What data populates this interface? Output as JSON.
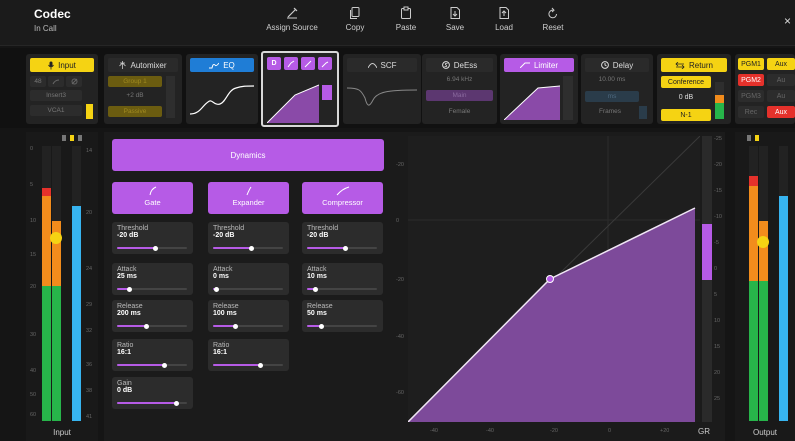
{
  "app": {
    "title": "Codec",
    "subtitle": "In Call",
    "close": "×"
  },
  "toolbar": [
    {
      "label": "Assign Source",
      "icon": "pen-icon"
    },
    {
      "label": "Copy",
      "icon": "copy-icon"
    },
    {
      "label": "Paste",
      "icon": "paste-icon"
    },
    {
      "label": "Save",
      "icon": "save-icon"
    },
    {
      "label": "Load",
      "icon": "load-icon"
    },
    {
      "label": "Reset",
      "icon": "reset-icon"
    }
  ],
  "modules": {
    "input": {
      "label": "Input",
      "row1": [
        "48",
        "",
        ""
      ],
      "row2": "Insert3",
      "row3": "VCA1"
    },
    "automixer": {
      "label": "Automixer",
      "group": "Group 1",
      "gain": "+2 dB",
      "mode": "Passive"
    },
    "eq": {
      "label": "EQ"
    },
    "dyn": {
      "tab": "D"
    },
    "scf": {
      "label": "SCF"
    },
    "deess": {
      "label": "DeEss",
      "freq": "6.94 kHz",
      "mode": "Main",
      "voice": "Female"
    },
    "limiter": {
      "label": "Limiter"
    },
    "delay": {
      "label": "Delay",
      "time": "10.00 ms",
      "unit": "ms",
      "mode": "Frames"
    },
    "return": {
      "label": "Return",
      "source": "Conference",
      "level": "0 dB",
      "mix": "N-1"
    },
    "pgm": {
      "p1": "PGM1",
      "p2": "PGM2",
      "p3": "PGM3",
      "rec": "Rec",
      "aux1": "Aux",
      "aux2": "Au",
      "aux3": "Au",
      "aux4": "Aux"
    }
  },
  "meters": {
    "input_label": "Input",
    "output_label": "Output",
    "scale": [
      "0",
      "5",
      "10",
      "15",
      "20",
      "30",
      "40",
      "50",
      "60"
    ],
    "scale_right": [
      "14",
      "20",
      "24",
      "29",
      "32",
      "36",
      "38",
      "41"
    ],
    "input_level": 0.61,
    "input_level_b": 0.72
  },
  "dynamics": {
    "title": "Dynamics",
    "buttons": [
      "Gate",
      "Expander",
      "Compressor"
    ],
    "gate": [
      {
        "label": "Threshold",
        "value": "-20 dB",
        "pos": 0.55
      },
      {
        "label": "Attack",
        "value": "25 ms",
        "pos": 0.18
      },
      {
        "label": "Release",
        "value": "200 ms",
        "pos": 0.42
      },
      {
        "label": "Ratio",
        "value": "16:1",
        "pos": 0.68
      },
      {
        "label": "Gain",
        "value": "0 dB",
        "pos": 0.85
      }
    ],
    "expander": [
      {
        "label": "Threshold",
        "value": "-20 dB",
        "pos": 0.55
      },
      {
        "label": "Attack",
        "value": "0 ms",
        "pos": 0.05
      },
      {
        "label": "Release",
        "value": "100 ms",
        "pos": 0.32
      },
      {
        "label": "Ratio",
        "value": "16:1",
        "pos": 0.68
      }
    ],
    "compressor": [
      {
        "label": "Threshold",
        "value": "-20 dB",
        "pos": 0.55
      },
      {
        "label": "Attack",
        "value": "10 ms",
        "pos": 0.12
      },
      {
        "label": "Release",
        "value": "50 ms",
        "pos": 0.2
      }
    ]
  },
  "graph": {
    "y_labels": [
      "-20",
      "0",
      "-20",
      "-40",
      "-60"
    ],
    "x_labels": [
      "-40",
      "-40",
      "-20",
      "0",
      "+20"
    ],
    "gr_label": "GR",
    "gr_scale": [
      "-25",
      "-20",
      "-15",
      "-10",
      "-5",
      "0",
      "5",
      "10",
      "15",
      "20",
      "25"
    ],
    "gr_amount": 0.22
  },
  "colors": {
    "accent": "#b65be6",
    "yellow": "#f5d313",
    "red": "#e5312b",
    "green": "#27b44a",
    "cyan": "#37b4f0",
    "orange": "#f28c1c"
  }
}
